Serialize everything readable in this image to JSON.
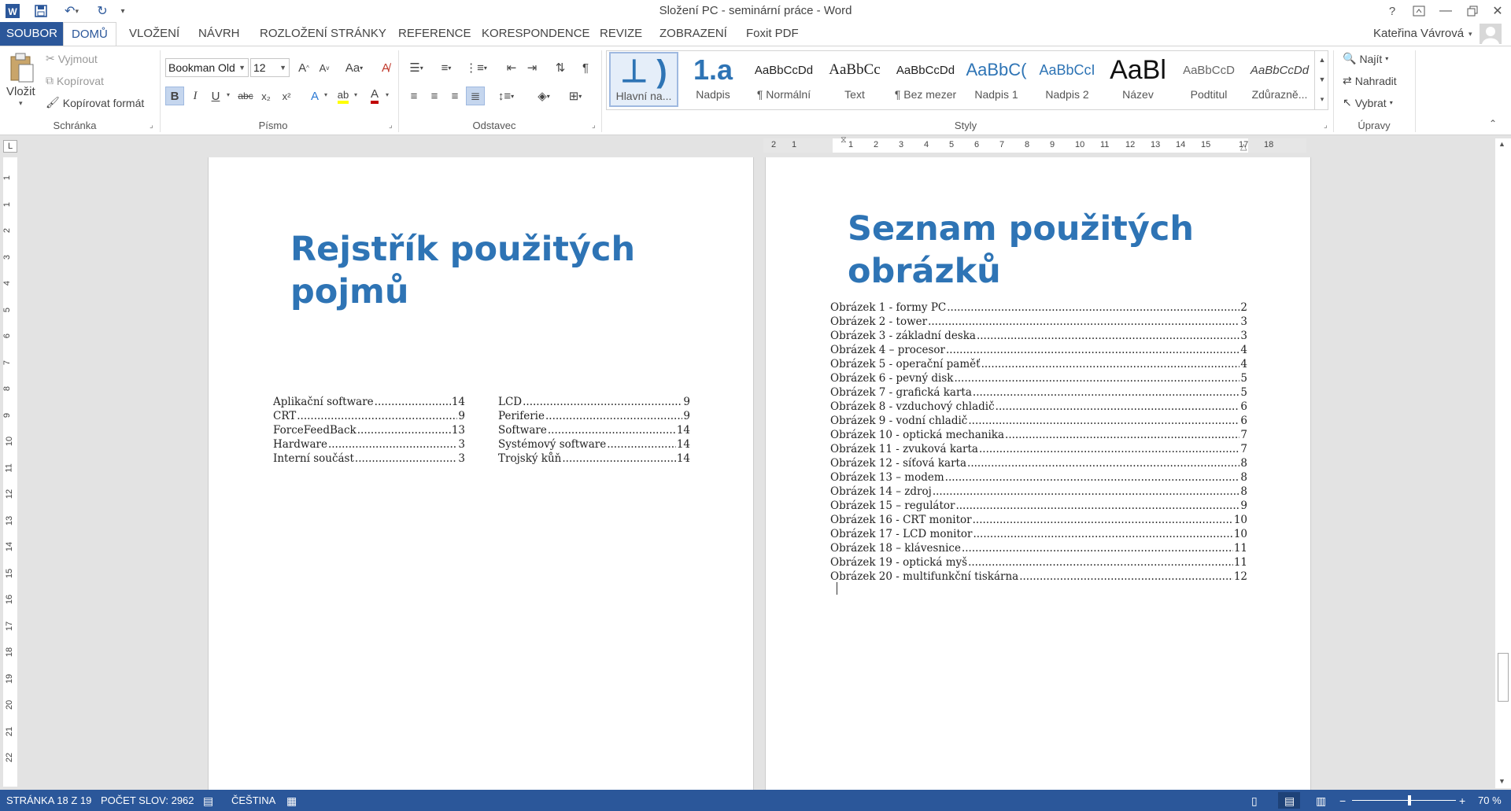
{
  "window": {
    "title": "Složení PC - seminární práce - Word",
    "help": "?",
    "icons": [
      "word-icon",
      "save-icon",
      "undo-icon",
      "redo-icon",
      "customize-qat-icon"
    ]
  },
  "tabs": [
    "SOUBOR",
    "DOMŮ",
    "VLOŽENÍ",
    "NÁVRH",
    "ROZLOŽENÍ STRÁNKY",
    "REFERENCE",
    "KORESPONDENCE",
    "REVIZE",
    "ZOBRAZENÍ",
    "Foxit PDF"
  ],
  "user": "Kateřina Vávrová",
  "ribbon": {
    "clipboard": {
      "paste": "Vložit",
      "cut": "Vyjmout",
      "copy": "Kopírovat",
      "format_painter": "Kopírovat formát",
      "label": "Schránka"
    },
    "font": {
      "name": "Bookman Old",
      "size": "12",
      "label": "Písmo"
    },
    "paragraph": {
      "label": "Odstavec"
    },
    "styles": {
      "label": "Styly",
      "items": [
        {
          "preview": "⊥ )",
          "name": "Hlavní na..."
        },
        {
          "preview": "1.a",
          "name": "Nadpis"
        },
        {
          "preview": "AaBbCcDd",
          "name": "¶ Normální"
        },
        {
          "preview": "AaBbCc",
          "name": "Text"
        },
        {
          "preview": "AaBbCcDd",
          "name": "¶ Bez mezer"
        },
        {
          "preview": "AaBbC(",
          "name": "Nadpis 1"
        },
        {
          "preview": "AaBbCcI",
          "name": "Nadpis 2"
        },
        {
          "preview": "AaBl",
          "name": "Název"
        },
        {
          "preview": "AaBbCcD",
          "name": "Podtitul"
        },
        {
          "preview": "AaBbCcDd",
          "name": "Zdůrazně..."
        }
      ]
    },
    "editing": {
      "find": "Najít",
      "replace": "Nahradit",
      "select": "Vybrat",
      "label": "Úpravy"
    }
  },
  "ruler": {
    "h": [
      "2",
      "1",
      "1",
      "2",
      "3",
      "4",
      "5",
      "6",
      "7",
      "8",
      "9",
      "10",
      "11",
      "12",
      "13",
      "14",
      "15",
      "17",
      "18"
    ],
    "v": [
      "1",
      "1",
      "2",
      "3",
      "4",
      "5",
      "6",
      "7",
      "8",
      "9",
      "10",
      "11",
      "12",
      "13",
      "14",
      "15",
      "16",
      "17",
      "18",
      "19",
      "20",
      "21",
      "22"
    ]
  },
  "page1": {
    "heading_line1": "Rejstřík použitých",
    "heading_line2": "pojmů",
    "index_col1": [
      {
        "term": "Aplikační software",
        "page": "14"
      },
      {
        "term": "CRT",
        "page": "9"
      },
      {
        "term": "ForceFeedBack",
        "page": "13"
      },
      {
        "term": "Hardware",
        "page": "3"
      },
      {
        "term": "Interní součást",
        "page": "3"
      }
    ],
    "index_col2": [
      {
        "term": "LCD",
        "page": "9"
      },
      {
        "term": "Periferie",
        "page": "9"
      },
      {
        "term": "Software",
        "page": "14"
      },
      {
        "term": "Systémový software",
        "page": "14"
      },
      {
        "term": "Trojský kůň",
        "page": "14"
      }
    ]
  },
  "page2": {
    "heading_line1": "Seznam použitých",
    "heading_line2": "obrázků",
    "figures": [
      {
        "label": "Obrázek 1 - formy PC",
        "page": "2"
      },
      {
        "label": "Obrázek 2 - tower",
        "page": "3"
      },
      {
        "label": "Obrázek 3 - základní deska",
        "page": "3"
      },
      {
        "label": "Obrázek 4 – procesor",
        "page": "4"
      },
      {
        "label": "Obrázek 5 - operační paměť",
        "page": "4"
      },
      {
        "label": "Obrázek 6 - pevný disk",
        "page": "5"
      },
      {
        "label": "Obrázek 7 - grafická karta",
        "page": "5"
      },
      {
        "label": "Obrázek 8 - vzduchový chladič",
        "page": "6"
      },
      {
        "label": "Obrázek 9 - vodní chladič",
        "page": "6"
      },
      {
        "label": "Obrázek 10 - optická mechanika",
        "page": "7"
      },
      {
        "label": "Obrázek 11 - zvuková karta",
        "page": "7"
      },
      {
        "label": "Obrázek 12 - síťová karta",
        "page": "8"
      },
      {
        "label": "Obrázek 13 – modem",
        "page": "8"
      },
      {
        "label": "Obrázek 14 – zdroj",
        "page": "8"
      },
      {
        "label": "Obrázek 15 – regulátor",
        "page": "9"
      },
      {
        "label": "Obrázek 16 - CRT monitor",
        "page": "10"
      },
      {
        "label": "Obrázek 17 - LCD monitor",
        "page": "10"
      },
      {
        "label": "Obrázek 18 – klávesnice",
        "page": "11"
      },
      {
        "label": "Obrázek 19 - optická myš",
        "page": "11"
      },
      {
        "label": "Obrázek 20 - multifunkční tiskárna",
        "page": "12"
      }
    ]
  },
  "status": {
    "page": "STRÁNKA 18 Z 19",
    "words": "POČET SLOV: 2962",
    "language": "ČEŠTINA",
    "zoom": "70 %",
    "zoom_minus": "−",
    "zoom_plus": "+",
    "zoom_fraction": 0.55
  }
}
